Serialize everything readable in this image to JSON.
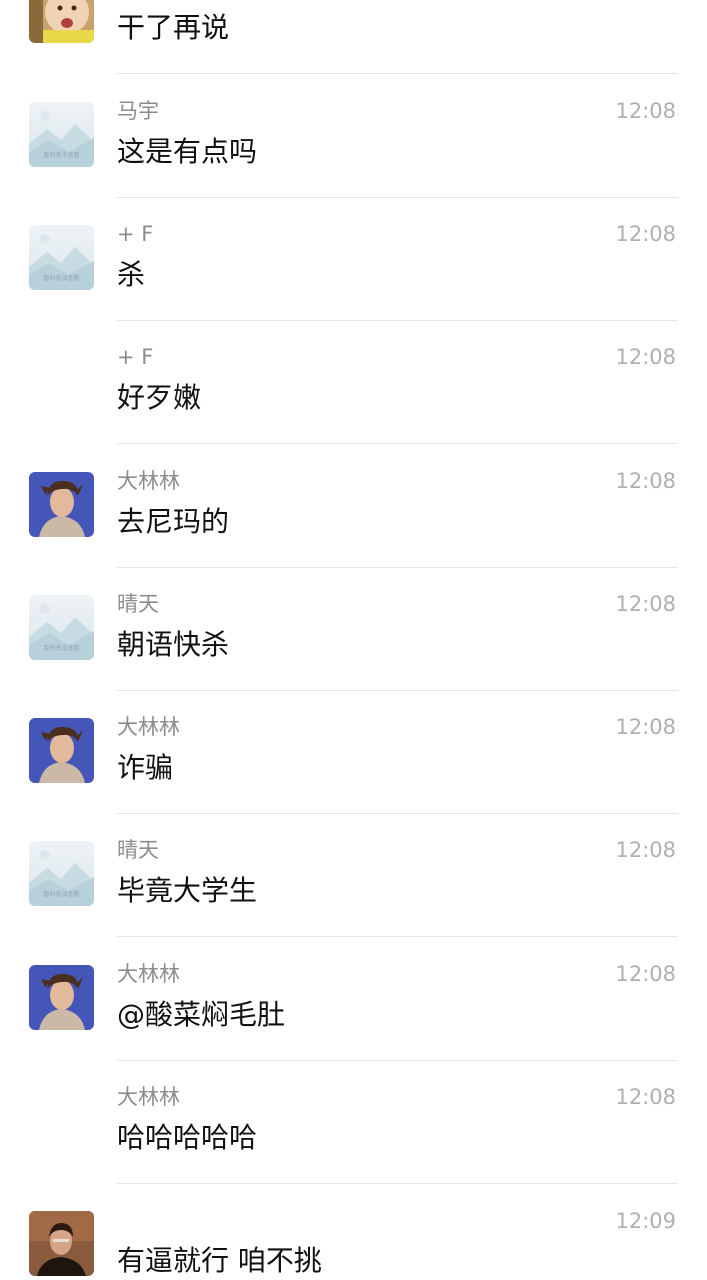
{
  "messages": [
    {
      "text": "干了再说",
      "avatar": "baby-photo"
    },
    {
      "name": "马宇",
      "time": "12:08",
      "text": "这是有点吗",
      "avatar": "image-placeholder",
      "placeholder_caption": "暂时无法查看"
    },
    {
      "name": "+ F",
      "time": "12:08",
      "text": "杀",
      "avatar": "image-placeholder",
      "placeholder_caption": "暂时无法查看"
    },
    {
      "name": "+ F",
      "time": "12:08",
      "text": "好歹嫩"
    },
    {
      "name": "大林林",
      "time": "12:08",
      "text": "去尼玛的",
      "avatar": "man-photo"
    },
    {
      "name": "晴天",
      "time": "12:08",
      "text": "朝语快杀",
      "avatar": "image-placeholder",
      "placeholder_caption": "暂时无法查看"
    },
    {
      "name": "大林林",
      "time": "12:08",
      "text": "诈骗",
      "avatar": "man-photo"
    },
    {
      "name": "晴天",
      "time": "12:08",
      "text": "毕竟大学生",
      "avatar": "image-placeholder",
      "placeholder_caption": "暂时无法查看"
    },
    {
      "name": "大林林",
      "time": "12:08",
      "text": "@酸菜焖毛肚",
      "avatar": "man-photo"
    },
    {
      "name": "大林林",
      "time": "12:08",
      "text": "哈哈哈哈哈"
    },
    {
      "time": "12:09",
      "text": "有逼就行 咱不挑",
      "avatar": "portrait-photo"
    }
  ]
}
